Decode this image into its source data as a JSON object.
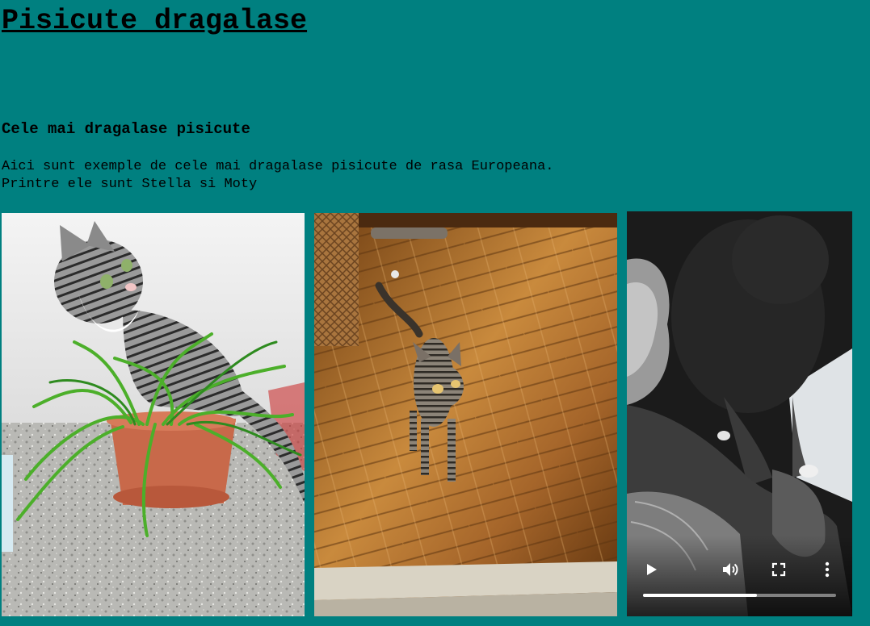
{
  "page": {
    "title": "Pisicute dragalase",
    "subtitle": "Cele mai dragalase pisicute",
    "description_line1": "Aici sunt exemple de cele mai dragalase pisicute de rasa Europeana.",
    "description_line2": "Printre ele sunt Stella si Moty"
  },
  "colors": {
    "background": "#008080",
    "text": "#000000"
  },
  "media": {
    "photo1": {
      "subject": "tabby cat sitting in a pot of grass"
    },
    "photo2": {
      "subject": "tabby kitten standing on parquet floor"
    },
    "video": {
      "controls": {
        "play_icon": "play-icon",
        "volume_icon": "volume-icon",
        "fullscreen_icon": "fullscreen-icon",
        "more_icon": "more-vertical-icon"
      },
      "progress": 0.59
    }
  }
}
